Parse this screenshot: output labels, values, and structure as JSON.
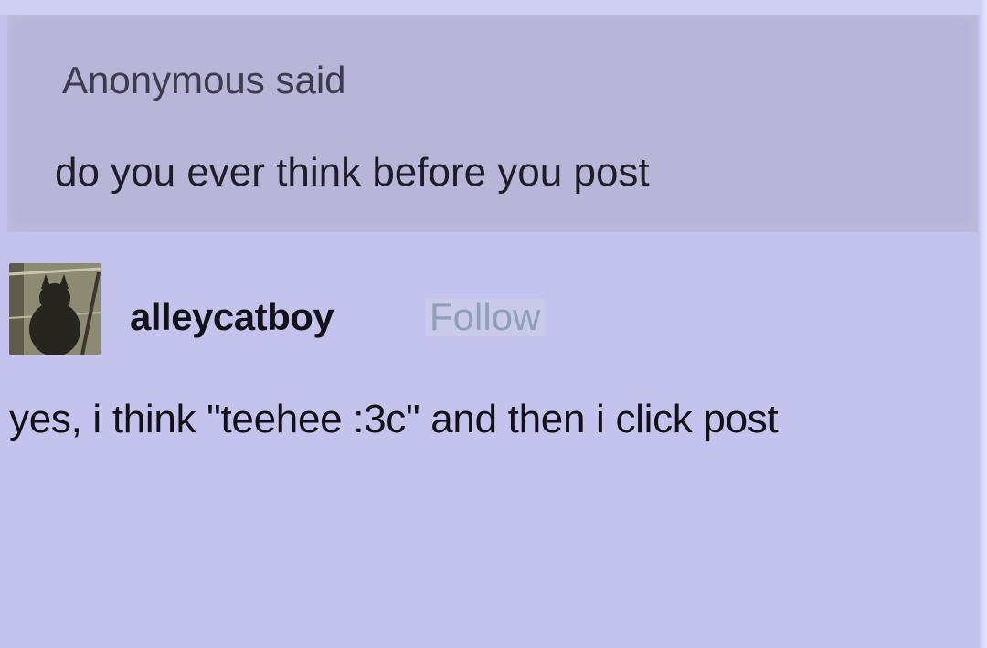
{
  "ask": {
    "asker": "Anonymous said",
    "question": "do you ever think before you post"
  },
  "answer": {
    "username": "alleycatboy",
    "follow_label": "Follow",
    "text": "yes, i think \"teehee :3c\" and then i click post"
  },
  "icons": {
    "avatar": "cat-avatar"
  }
}
